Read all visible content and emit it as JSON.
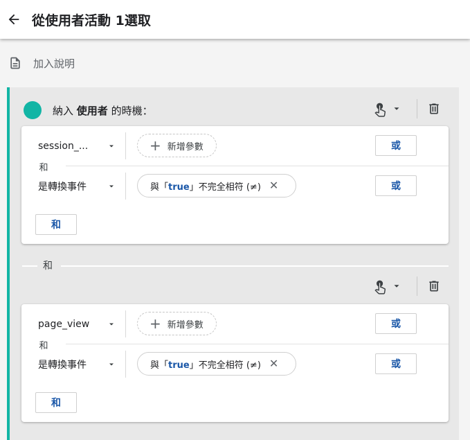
{
  "header": {
    "title": "從使用者活動 1選取",
    "back_icon": "arrow-back-icon"
  },
  "description": {
    "label": "加入說明",
    "icon": "document-icon"
  },
  "group": {
    "accent_color": "#12b5a5",
    "include_prefix": "納入",
    "include_subject": "使用者",
    "include_suffix": "的時機："
  },
  "separator_label": "和",
  "cards": [
    {
      "conditions": [
        {
          "dimension": "session_...",
          "chip_type": "add",
          "chip_label": "新增參數",
          "or_label": "或"
        },
        {
          "dimension": "是轉換事件",
          "chip_type": "value",
          "chip_prefix": "與「",
          "chip_value": "true",
          "chip_suffix": "」不完全相符 (≠)",
          "or_label": "或"
        }
      ],
      "and_mini": "和",
      "and_button": "和"
    },
    {
      "conditions": [
        {
          "dimension": "page_view",
          "chip_type": "add",
          "chip_label": "新增參數",
          "or_label": "或"
        },
        {
          "dimension": "是轉換事件",
          "chip_type": "value",
          "chip_prefix": "與「",
          "chip_value": "true",
          "chip_suffix": "」不完全相符 (≠)",
          "or_label": "或"
        }
      ],
      "and_mini": "和",
      "and_button": "和"
    }
  ]
}
